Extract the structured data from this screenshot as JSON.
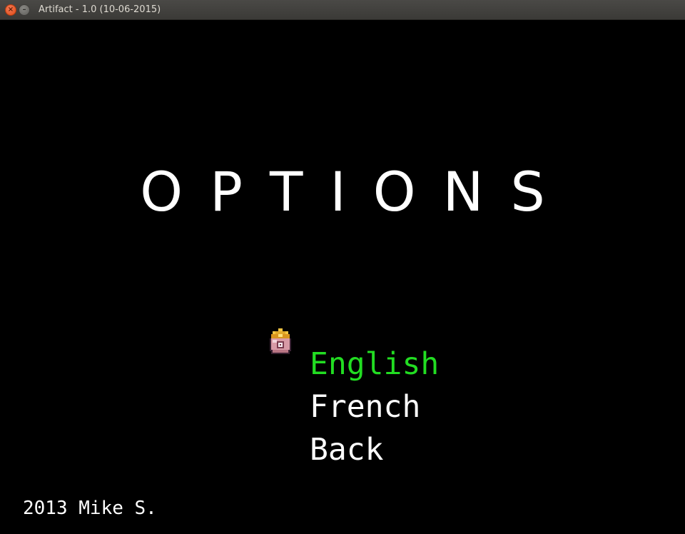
{
  "window": {
    "title": "Artifact - 1.0 (10-06-2015)",
    "close_glyph": "×",
    "minimize_glyph": "–"
  },
  "screen": {
    "heading": "OPTIONS",
    "menu": [
      {
        "label": "English",
        "selected": true
      },
      {
        "label": "French",
        "selected": false
      },
      {
        "label": "Back",
        "selected": false
      }
    ],
    "selection_icon": "orb-crown-cursor-icon",
    "credit": "2013 Mike S."
  },
  "colors": {
    "background": "#000000",
    "text": "#ffffff",
    "selected": "#22dd22",
    "close_button": "#df4b16"
  }
}
